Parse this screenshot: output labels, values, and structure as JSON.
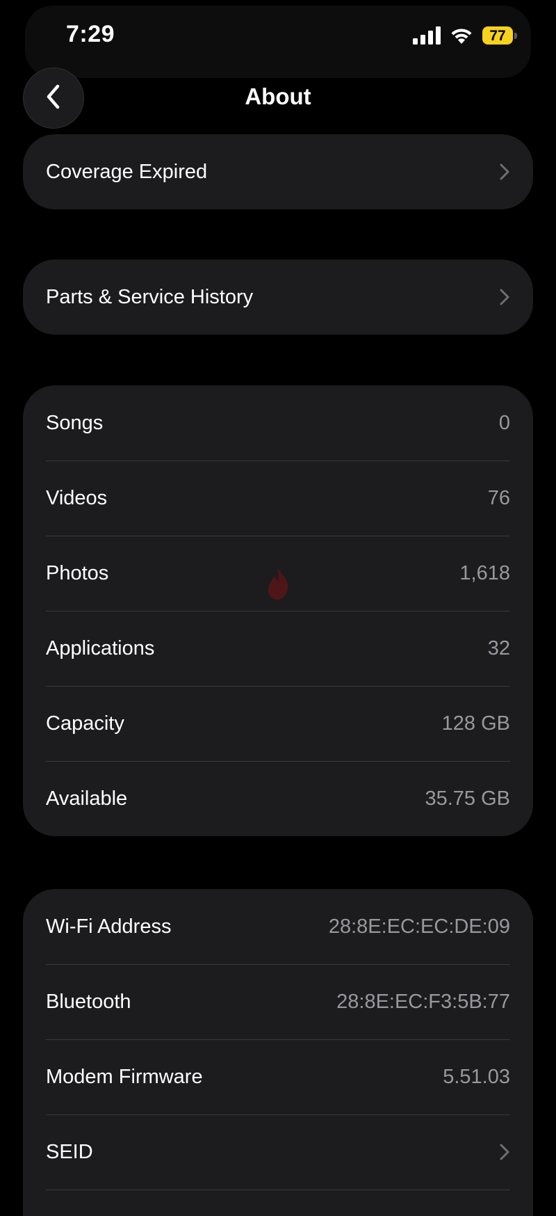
{
  "status_bar": {
    "time": "7:29",
    "battery": "77",
    "icons": [
      "signal-icon",
      "wifi-icon",
      "battery-icon"
    ]
  },
  "nav": {
    "title": "About",
    "back_icon": "chevron-left-icon"
  },
  "coverage": {
    "label": "Coverage Expired"
  },
  "service": {
    "label": "Parts & Service History"
  },
  "stats": [
    {
      "label": "Songs",
      "value": "0"
    },
    {
      "label": "Videos",
      "value": "76"
    },
    {
      "label": "Photos",
      "value": "1,618"
    },
    {
      "label": "Applications",
      "value": "32"
    },
    {
      "label": "Capacity",
      "value": "128 GB"
    },
    {
      "label": "Available",
      "value": "35.75 GB"
    }
  ],
  "network": [
    {
      "label": "Wi-Fi Address",
      "value": "28:8E:EC:EC:DE:09"
    },
    {
      "label": "Bluetooth",
      "value": "28:8E:EC:F3:5B:77"
    },
    {
      "label": "Modem Firmware",
      "value": "5.51.03"
    },
    {
      "label": "SEID",
      "value": ""
    }
  ],
  "colors": {
    "background": "#000000",
    "cell": "#1c1c1e",
    "separator": "#3a3a3c",
    "secondary_text": "#98989f",
    "battery": "#f7d21c"
  }
}
